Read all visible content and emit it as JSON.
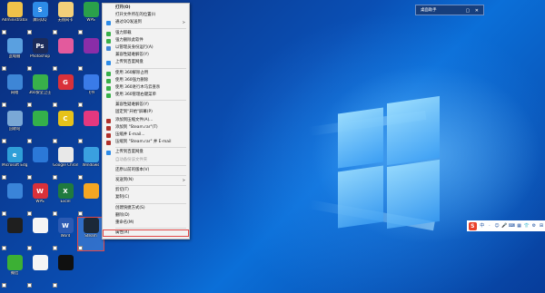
{
  "desktop_icons": [
    {
      "label": "Administrator",
      "color": "#f0c24a",
      "glyph": ""
    },
    {
      "label": "腾讯QQ",
      "color": "#2d8be8",
      "glyph": "S"
    },
    {
      "label": "无线网卡",
      "color": "#f3d07a",
      "glyph": ""
    },
    {
      "label": "WPS",
      "color": "#2aa04a",
      "glyph": ""
    },
    {
      "label": "此电脑",
      "color": "#5aa0e0",
      "glyph": ""
    },
    {
      "label": "Photoshop",
      "color": "#1b2b5a",
      "glyph": "Ps"
    },
    {
      "label": "",
      "color": "#e35a9d",
      "glyph": ""
    },
    {
      "label": "",
      "color": "#8a2da8",
      "glyph": ""
    },
    {
      "label": "网络",
      "color": "#3e86d6",
      "glyph": ""
    },
    {
      "label": "360安全卫士",
      "color": "#38b04a",
      "glyph": ""
    },
    {
      "label": "",
      "color": "#d9313a",
      "glyph": "G"
    },
    {
      "label": "飞书",
      "color": "#3a7be8",
      "glyph": ""
    },
    {
      "label": "回收站",
      "color": "#7aa8d6",
      "glyph": ""
    },
    {
      "label": "",
      "color": "#34b04a",
      "glyph": ""
    },
    {
      "label": "",
      "color": "#e6c21a",
      "glyph": "C"
    },
    {
      "label": "",
      "color": "#e3387f",
      "glyph": ""
    },
    {
      "label": "Microsoft Edge",
      "color": "#2f9fd8",
      "glyph": "e"
    },
    {
      "label": "",
      "color": "#2b78d8",
      "glyph": ""
    },
    {
      "label": "Google Chrome",
      "color": "#e8e8e8",
      "glyph": ""
    },
    {
      "label": "Windows",
      "color": "#3aa0e0",
      "glyph": ""
    },
    {
      "label": "",
      "color": "#3a84d8",
      "glyph": ""
    },
    {
      "label": "WPS",
      "color": "#d9313a",
      "glyph": "W"
    },
    {
      "label": "Excel",
      "color": "#1f7a3f",
      "glyph": "X"
    },
    {
      "label": "",
      "color": "#f4a623",
      "glyph": ""
    },
    {
      "label": "",
      "color": "#1f1f1f",
      "glyph": ""
    },
    {
      "label": "",
      "color": "#f5f5f5",
      "glyph": ""
    },
    {
      "label": "Word",
      "color": "#2b5ab3",
      "glyph": "W"
    },
    {
      "label": "Steam",
      "color": "#1b2838",
      "glyph": ""
    },
    {
      "label": "微信",
      "color": "#3cb034",
      "glyph": ""
    },
    {
      "label": "",
      "color": "#f5f5f5",
      "glyph": ""
    },
    {
      "label": "",
      "color": "#101010",
      "glyph": ""
    }
  ],
  "context_menu": {
    "items": [
      {
        "label": "打开(O)",
        "bold": true,
        "icon_color": "",
        "sub": ""
      },
      {
        "label": "打开文件所在的位置(I)",
        "icon_color": "",
        "sub": ""
      },
      {
        "label": "通过QQ发送到",
        "icon_color": "#2d8be8",
        "sub": ">"
      },
      {
        "sep": true
      },
      {
        "label": "强力卸载",
        "icon_color": "#38b04a",
        "sub": ""
      },
      {
        "label": "强力删除此软件",
        "icon_color": "#38b04a",
        "sub": ""
      },
      {
        "label": "以管理员身份运行(A)",
        "icon_color": "#3e86d6",
        "sub": ""
      },
      {
        "label": "兼容性疑难解答(Y)",
        "icon_color": "",
        "sub": ""
      },
      {
        "label": "上传到百度网盘",
        "icon_color": "#2d8be8",
        "sub": ""
      },
      {
        "sep": true
      },
      {
        "label": "使用 360解除占用",
        "icon_color": "#38b04a",
        "sub": ""
      },
      {
        "label": "使用 360强力删除",
        "icon_color": "#38b04a",
        "sub": ""
      },
      {
        "label": "使用 360进行木马云查杀",
        "icon_color": "#38b04a",
        "sub": ""
      },
      {
        "label": "使用 360管理右键菜单",
        "icon_color": "#38b04a",
        "sub": ""
      },
      {
        "sep": true
      },
      {
        "label": "兼容性疑难解答(Y)",
        "icon_color": "",
        "sub": ""
      },
      {
        "label": "固定到\"开始\"屏幕(P)",
        "icon_color": "",
        "sub": ""
      },
      {
        "label": "添加到压缩文件(A)...",
        "icon_color": "#b0302a",
        "sub": ""
      },
      {
        "label": "添加到 \"Steam.rar\"(T)",
        "icon_color": "#b0302a",
        "sub": ""
      },
      {
        "label": "压缩并 E-mail...",
        "icon_color": "#b0302a",
        "sub": ""
      },
      {
        "label": "压缩到 \"Steam.rar\" 并 E-mail",
        "icon_color": "#b0302a",
        "sub": ""
      },
      {
        "sep": true
      },
      {
        "label": "上传到百度网盘",
        "icon_color": "#2d8be8",
        "sub": ""
      },
      {
        "label": "自动备份该文件夹",
        "icon_color": "",
        "sub": "",
        "disabled": true
      },
      {
        "sep": true
      },
      {
        "label": "还原以前的版本(V)",
        "icon_color": "",
        "sub": ""
      },
      {
        "sep": true
      },
      {
        "label": "发送到(N)",
        "icon_color": "",
        "sub": ">"
      },
      {
        "sep": true
      },
      {
        "label": "剪切(T)",
        "icon_color": "",
        "sub": ""
      },
      {
        "label": "复制(C)",
        "icon_color": "",
        "sub": ""
      },
      {
        "sep": true
      },
      {
        "label": "创建快捷方式(S)",
        "icon_color": "",
        "sub": ""
      },
      {
        "label": "删除(D)",
        "icon_color": "",
        "sub": ""
      },
      {
        "label": "重命名(M)",
        "icon_color": "",
        "sub": ""
      },
      {
        "sep": true
      },
      {
        "label": "属性(R)",
        "icon_color": "",
        "sub": "",
        "highlight": true
      }
    ]
  },
  "taskbar_panel": {
    "title": "桌面助手",
    "buttons": "▢ ✕"
  },
  "ime_bar": {
    "logo": "S",
    "glyphs": [
      "中",
      "·",
      "☺",
      "🎤",
      "⌨",
      "▦",
      "👕",
      "⚙",
      "⊞"
    ]
  }
}
